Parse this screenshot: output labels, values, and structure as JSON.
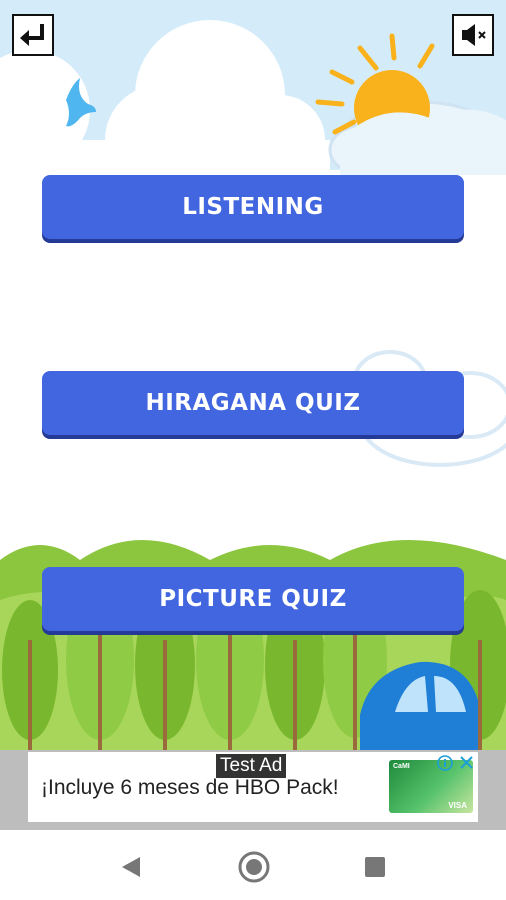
{
  "header": {
    "back_icon": "return-arrow-icon",
    "sound_icon": "speaker-muted-icon"
  },
  "menu": {
    "listening_label": "LISTENING",
    "hiragana_label": "HIRAGANA QUIZ",
    "picture_label": "PICTURE QUIZ"
  },
  "ad": {
    "label": "Test Ad",
    "text": "¡Incluye 6 meses de HBO Pack!",
    "card_brand": "CaMI",
    "card_network": "VISA"
  },
  "colors": {
    "button": "#4266e0",
    "sky": "#cfe9f8",
    "grass": "#8cc63f",
    "sun": "#f9b21b"
  },
  "navbar": {
    "back_icon": "triangle-back-icon",
    "home_icon": "circle-home-icon",
    "recents_icon": "square-recents-icon"
  }
}
